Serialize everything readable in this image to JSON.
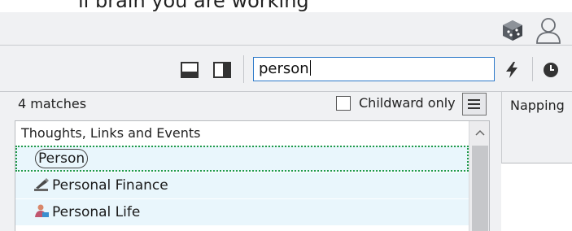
{
  "top_strip": {
    "text": "ll brain you are working"
  },
  "icons": {
    "cube": "cube-icon",
    "user": "user-icon",
    "layout_bottom": "layout-bottom-icon",
    "layout_right": "layout-right-icon",
    "bolt": "bolt-icon",
    "clock": "clock-icon",
    "menu": "hamburger-menu-icon",
    "finance": "finance-pen-icon",
    "life": "person-life-icon",
    "scroll_up": "chevron-up-icon"
  },
  "search": {
    "value": "person"
  },
  "results": {
    "match_count": "4 matches",
    "childward_only": {
      "label": "Childward only",
      "checked": false
    },
    "group_header": "Thoughts, Links and Events",
    "items": [
      {
        "label": "Person",
        "selected": true
      },
      {
        "label": "Personal Finance",
        "selected": false
      },
      {
        "label": "Personal Life",
        "selected": false
      }
    ]
  },
  "right_pane": {
    "tab_label": "Napping"
  },
  "colors": {
    "toolbar_bg": "#f0f1f3",
    "search_border": "#2c79c9",
    "row_highlight": "#e9f6fc",
    "selection_border": "#1f9a48"
  }
}
